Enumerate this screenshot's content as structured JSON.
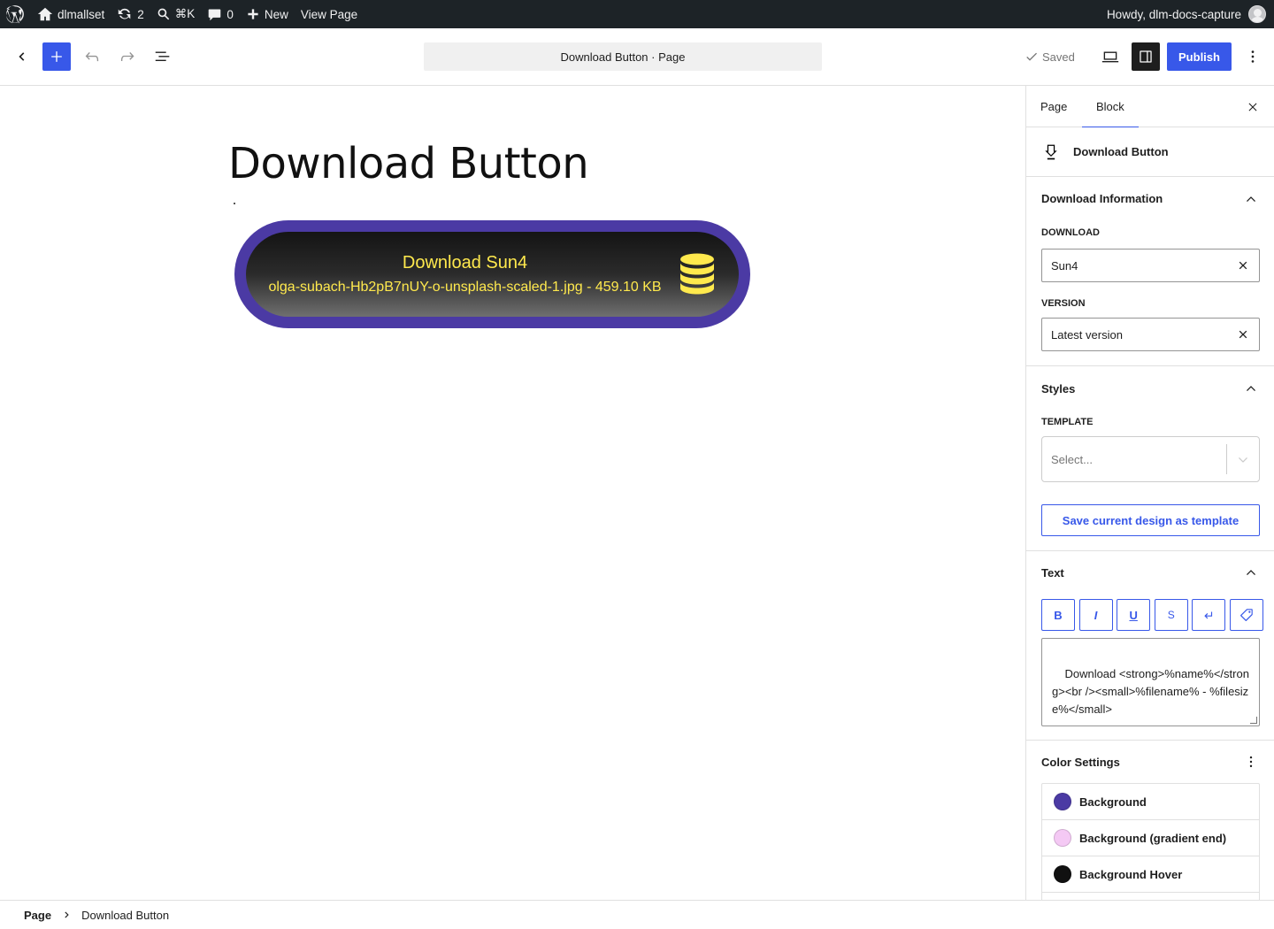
{
  "adminbar": {
    "site_name": "dlmallset",
    "updates_count": "2",
    "search_shortcut": "⌘K",
    "comments_count": "0",
    "new_label": "New",
    "view_page_label": "View Page",
    "howdy": "Howdy, dlm-docs-capture"
  },
  "header": {
    "doc_title": "Download Button · Page",
    "saved_label": "Saved",
    "publish_label": "Publish"
  },
  "canvas": {
    "post_title": "Download Button",
    "button_title": "Download Sun4",
    "button_subtitle": "olga-subach-Hb2pB7nUY-o-unsplash-scaled-1.jpg - 459.10 KB",
    "button_colors": {
      "border": "#4b3aa4",
      "text": "#ffe94d"
    }
  },
  "footer": {
    "root": "Page",
    "current": "Download Button"
  },
  "sidebar": {
    "tabs": [
      {
        "label": "Page"
      },
      {
        "label": "Block"
      }
    ],
    "block_name": "Download Button",
    "download_info": {
      "title": "Download Information",
      "download_label": "Download",
      "download_value": "Sun4",
      "version_label": "Version",
      "version_value": "Latest version"
    },
    "styles": {
      "title": "Styles",
      "template_label": "Template",
      "template_placeholder": "Select...",
      "save_template_label": "Save current design as template"
    },
    "text": {
      "title": "Text",
      "buttons": [
        "B",
        "I",
        "U",
        "S"
      ],
      "template_text": "Download <strong>%name%</strong><br /><small>%filename% - %filesize%</small>"
    },
    "colors": {
      "title": "Color Settings",
      "items": [
        {
          "label": "Background",
          "color": "#4b3aa4"
        },
        {
          "label": "Background (gradient end)",
          "color": "#f4c9f4"
        },
        {
          "label": "Background Hover",
          "color": "#111111"
        }
      ]
    }
  }
}
